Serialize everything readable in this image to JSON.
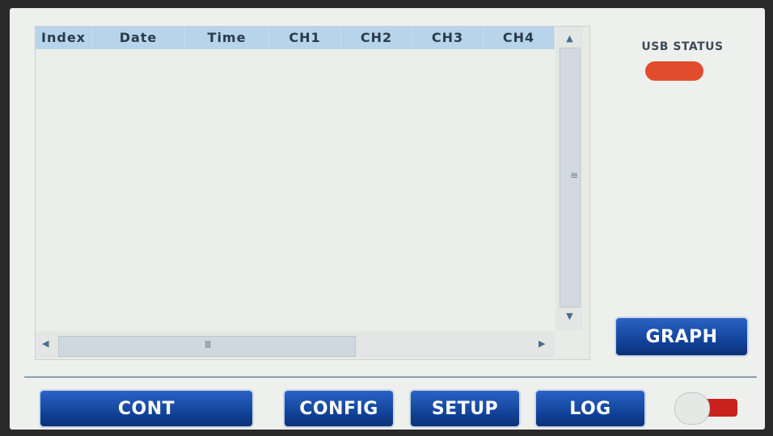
{
  "table": {
    "columns": [
      "Index",
      "Date",
      "Time",
      "CH1",
      "CH2",
      "CH3",
      "CH4"
    ]
  },
  "status": {
    "usb_label": "USB STATUS",
    "usb_led_color": "#e04c2c"
  },
  "buttons": {
    "graph": "GRAPH",
    "cont": "CONT",
    "config": "CONFIG",
    "setup": "SETUP",
    "log": "LOG"
  },
  "toggle": {
    "state": "off"
  },
  "icons": {
    "scroll_up": "▲",
    "scroll_down": "▼",
    "scroll_left": "◀",
    "scroll_right": "▶",
    "v_grip": "≡",
    "h_grip": "Ⅲ"
  }
}
